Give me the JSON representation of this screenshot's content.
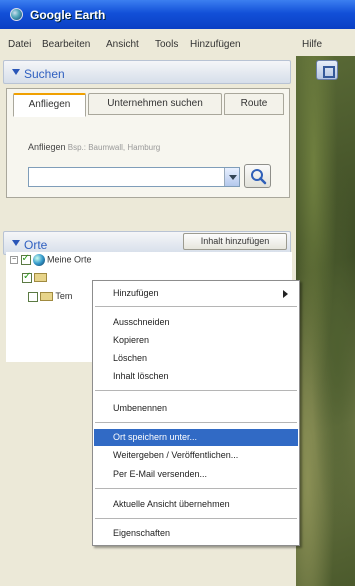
{
  "window": {
    "title": "Google Earth"
  },
  "menubar": [
    "Datei",
    "Bearbeiten",
    "Ansicht",
    "Tools",
    "Hinzufügen",
    "Hilfe"
  ],
  "search": {
    "header": "Suchen",
    "tabs": [
      "Anfliegen",
      "Unternehmen suchen",
      "Route"
    ],
    "hint_label": "Anfliegen",
    "hint_example": "Bsp.: Baumwall, Hamburg",
    "input_value": ""
  },
  "places": {
    "header": "Orte",
    "add_content_button": "Inhalt hinzufügen",
    "tree": [
      {
        "label": "Meine Orte"
      },
      {
        "label": ""
      },
      {
        "label": "Tem"
      }
    ]
  },
  "context_menu": {
    "items": [
      "Hinzufügen",
      "Ausschneiden",
      "Kopieren",
      "Löschen",
      "Inhalt löschen",
      "Umbenennen",
      "Ort speichern unter...",
      "Weitergeben / Veröffentlichen...",
      "Per E-Mail versenden...",
      "Aktuelle Ansicht übernehmen",
      "Eigenschaften"
    ],
    "selected": "Ort speichern unter..."
  }
}
